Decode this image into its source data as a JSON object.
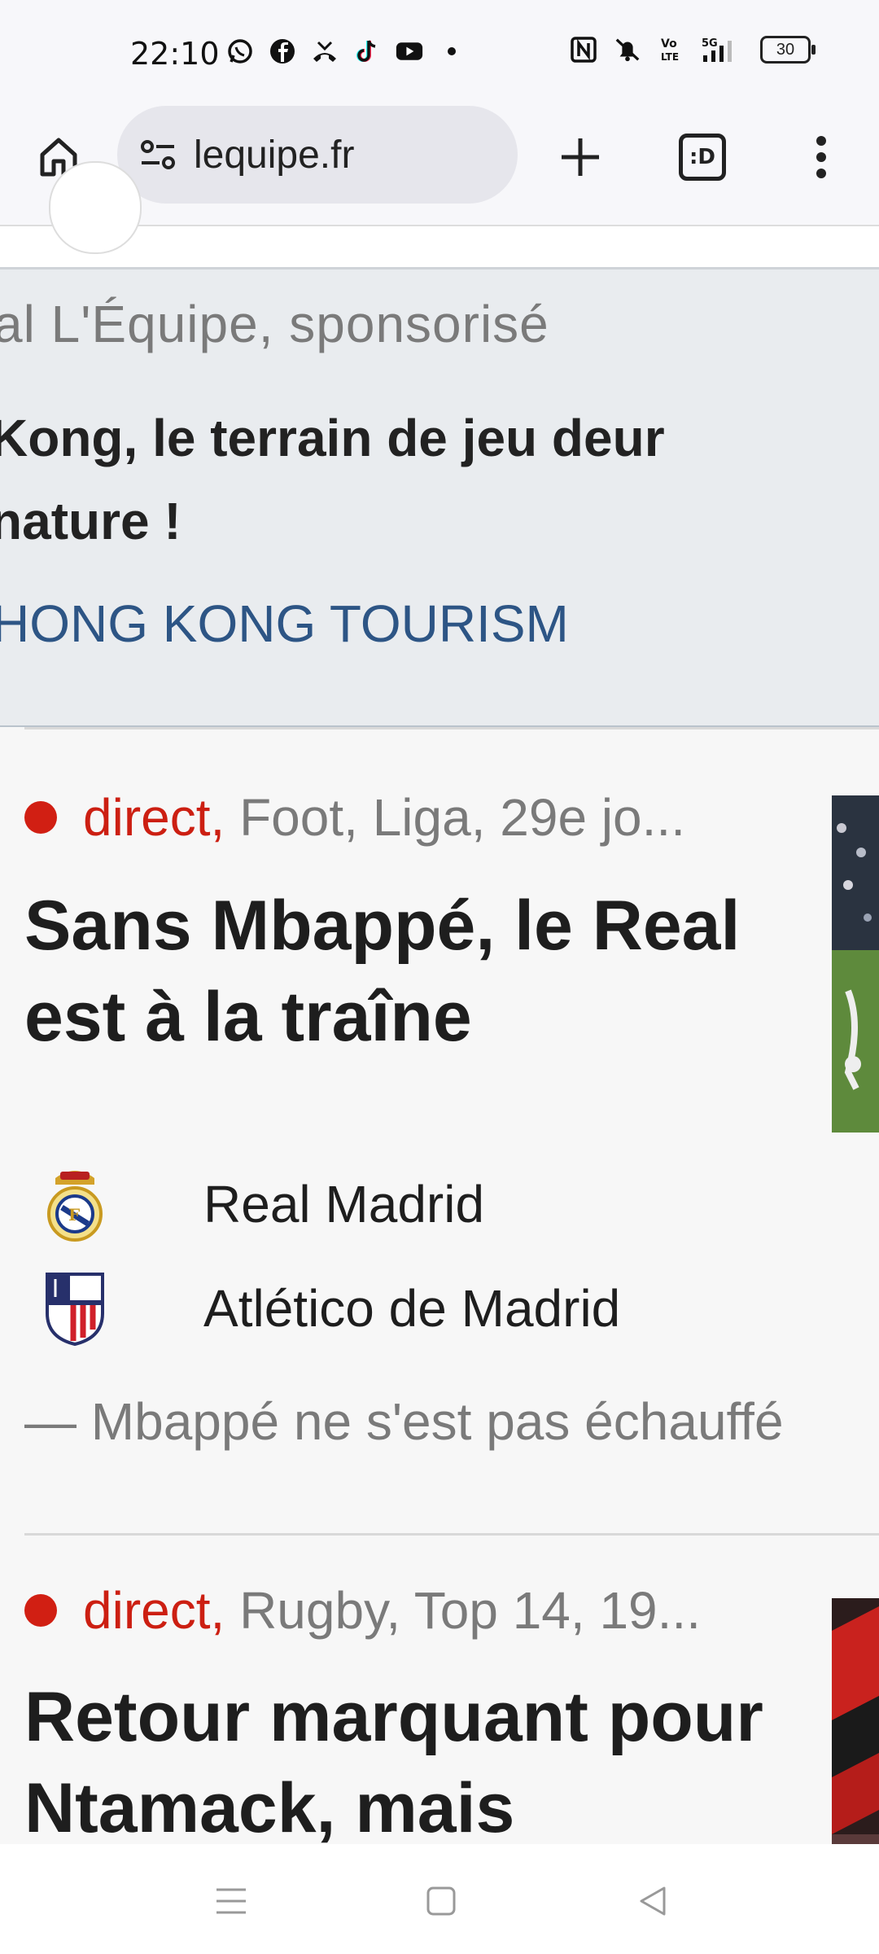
{
  "status_bar": {
    "time": "22:10",
    "left_icons": [
      "whatsapp-icon",
      "facebook-icon",
      "missed-call-icon",
      "tiktok-icon",
      "youtube-icon",
      "dot-icon"
    ],
    "right_icons": [
      "nfc-icon",
      "mute-icon",
      "volte-icon",
      "5g-signal-icon"
    ],
    "battery": "30"
  },
  "browser": {
    "url": "lequipe.fr",
    "tabs_label": ":D"
  },
  "ad": {
    "sponsor": "al L'Équipe, sponsorisé",
    "title": "Kong, le terrain de jeu deur nature !",
    "advertiser": "HONG KONG TOURISM"
  },
  "articles": [
    {
      "live": "direct,",
      "category": "Foot, Liga, 29e jo...",
      "headline": "Sans Mbappé, le Real est à la traîne",
      "teams": [
        {
          "name": "Real Madrid"
        },
        {
          "name": "Atlético de Madrid"
        }
      ],
      "summary": "— Mbappé ne s'est pas échauffé"
    },
    {
      "live": "direct,",
      "category": "Rugby, Top 14, 19...",
      "headline": "Retour marquant pour Ntamack, mais"
    }
  ],
  "colors": {
    "live_red": "#cc1f12",
    "advertiser_blue": "#2d5585",
    "muted_text": "#7a7a7a"
  }
}
